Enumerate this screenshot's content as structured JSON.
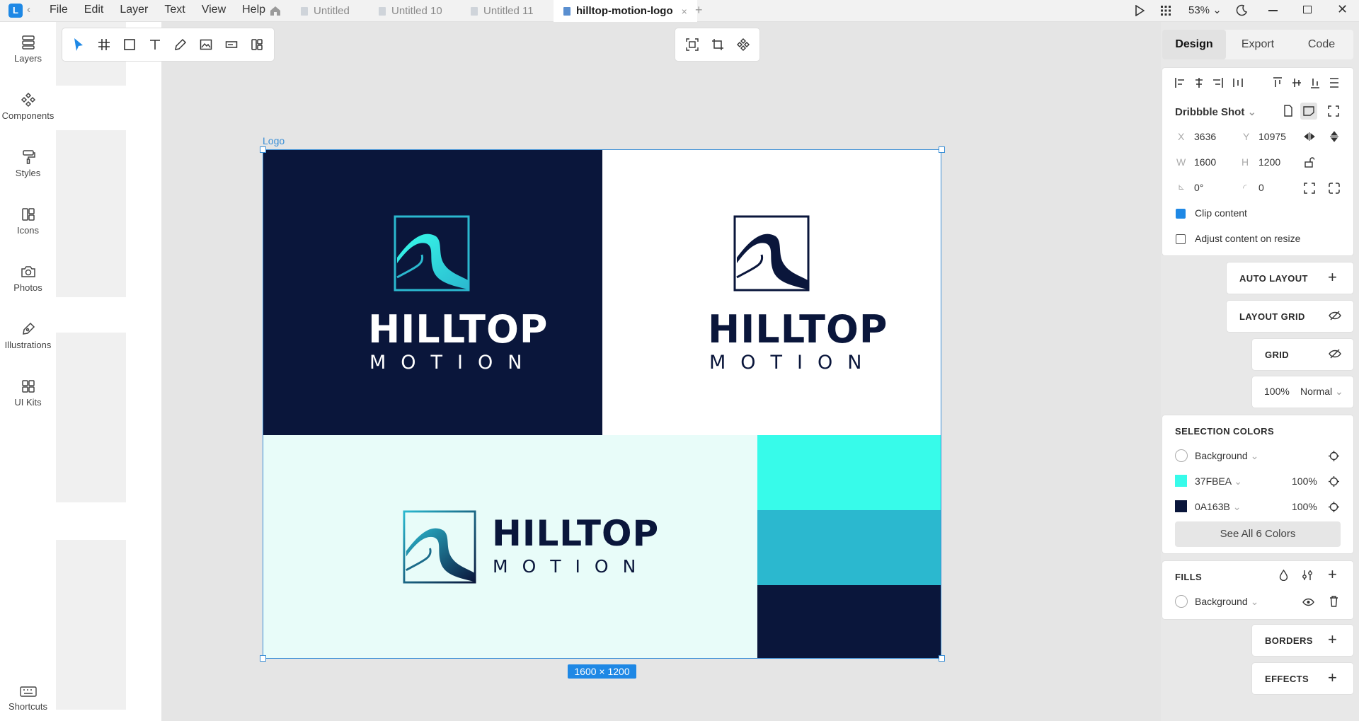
{
  "app": {
    "logo_letter": "L",
    "menu": [
      "File",
      "Edit",
      "Layer",
      "Text",
      "View",
      "Help"
    ],
    "tabs": [
      "Untitled",
      "Untitled 10",
      "Untitled 11",
      "hilltop-motion-logo"
    ],
    "tab_close": "×",
    "tab_add": "+",
    "zoom": "53%"
  },
  "sidebar": {
    "items": [
      {
        "label": "Layers",
        "icon": "layers-icon"
      },
      {
        "label": "Components",
        "icon": "components-icon"
      },
      {
        "label": "Styles",
        "icon": "paint-roller-icon"
      },
      {
        "label": "Icons",
        "icon": "icons-icon"
      },
      {
        "label": "Photos",
        "icon": "camera-icon"
      },
      {
        "label": "Illustrations",
        "icon": "pen-nib-icon"
      },
      {
        "label": "UI Kits",
        "icon": "grid-icon"
      }
    ],
    "shortcuts_label": "Shortcuts"
  },
  "canvas": {
    "frame_label": "Logo",
    "size_badge": "1600 × 1200",
    "logo_word": "HILLTOP",
    "logo_sub": "MOTION"
  },
  "panel": {
    "tabs": [
      "Design",
      "Export",
      "Code"
    ],
    "frame_preset": "Dribbble Shot",
    "x_label": "X",
    "x": "3636",
    "y_label": "Y",
    "y": "10975",
    "w_label": "W",
    "w": "1600",
    "h_label": "H",
    "h": "1200",
    "rotation": "0°",
    "radius": "0",
    "clip_content": "Clip content",
    "adjust_content": "Adjust content on resize",
    "auto_layout": "AUTO LAYOUT",
    "layout_grid": "LAYOUT GRID",
    "grid": "GRID",
    "grid_opacity": "100%",
    "blend_mode": "Normal",
    "selection_colors": "SELECTION COLORS",
    "colors": [
      {
        "name": "Background",
        "hex": "#ffffff",
        "opacity": ""
      },
      {
        "name": "37FBEA",
        "hex": "#37FBEA",
        "opacity": "100%"
      },
      {
        "name": "0A163B",
        "hex": "#0A163B",
        "opacity": "100%"
      }
    ],
    "see_all": "See All 6 Colors",
    "fills": "FILLS",
    "fill_name": "Background",
    "borders": "BORDERS",
    "effects": "EFFECTS"
  }
}
